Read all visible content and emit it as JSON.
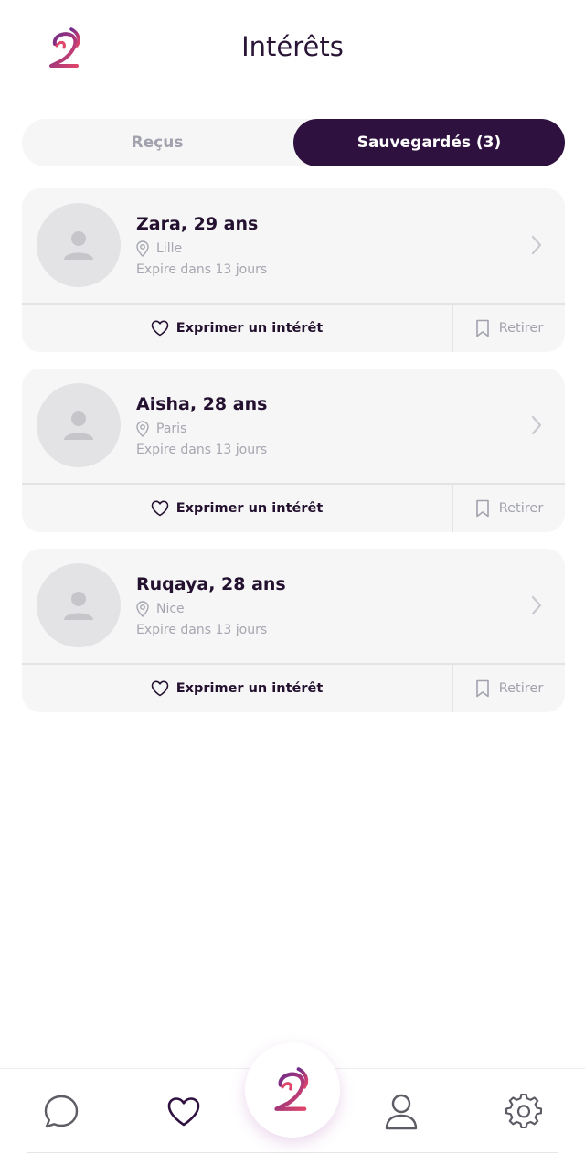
{
  "header": {
    "title": "Intérêts",
    "logo_icon": "brand-logo-icon"
  },
  "tabs": [
    {
      "label": "Reçus",
      "active": false
    },
    {
      "label": "Sauvegardés (3)",
      "active": true
    }
  ],
  "profiles": [
    {
      "name": "Zara, 29 ans",
      "location": "Lille",
      "expires": "Expire dans 13 jours",
      "interest_label": "Exprimer un intérêt",
      "remove_label": "Retirer"
    },
    {
      "name": "Aisha, 28 ans",
      "location": "Paris",
      "expires": "Expire dans 13 jours",
      "interest_label": "Exprimer un intérêt",
      "remove_label": "Retirer"
    },
    {
      "name": "Ruqaya, 28 ans",
      "location": "Nice",
      "expires": "Expire dans 13 jours",
      "interest_label": "Exprimer un intérêt",
      "remove_label": "Retirer"
    }
  ],
  "nav": {
    "items": [
      "chat-icon",
      "heart-icon",
      "brand-logo-icon",
      "profile-icon",
      "settings-icon"
    ],
    "active": "heart-icon"
  },
  "colors": {
    "primary": "#2f1140",
    "muted": "#a1a2ad",
    "card_bg": "#f6f6f7",
    "logo_gradient": [
      "#7b2a8a",
      "#e0456a"
    ]
  }
}
